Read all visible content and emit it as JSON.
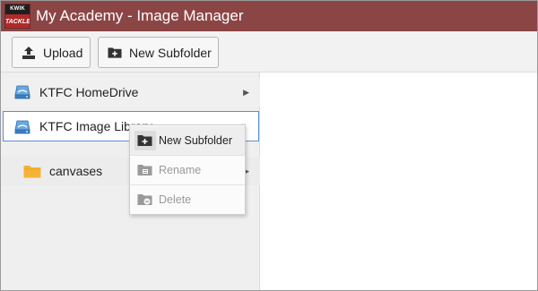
{
  "app": {
    "title": "My Academy - Image Manager",
    "logo": {
      "top_text": "KWIK",
      "bottom_text": "TACKLE"
    }
  },
  "toolbar": {
    "upload_label": "Upload",
    "new_subfolder_label": "New Subfolder"
  },
  "tree": {
    "items": [
      {
        "label": "KTFC HomeDrive",
        "icon": "drive-icon",
        "expanded": false
      },
      {
        "label": "KTFC Image Library",
        "icon": "drive-icon",
        "selected": true
      },
      {
        "label": "canvases",
        "icon": "folder-icon"
      }
    ]
  },
  "context_menu": {
    "items": [
      {
        "label": "New Subfolder",
        "icon": "new-folder-icon",
        "enabled": true
      },
      {
        "label": "Rename",
        "icon": "rename-folder-icon",
        "enabled": false
      },
      {
        "label": "Delete",
        "icon": "delete-folder-icon",
        "enabled": false
      }
    ]
  },
  "colors": {
    "titlebar": "#8c4545",
    "selection_border": "#5a8fd4",
    "folder": "#f5b335",
    "drive": "#4a8fd0"
  }
}
